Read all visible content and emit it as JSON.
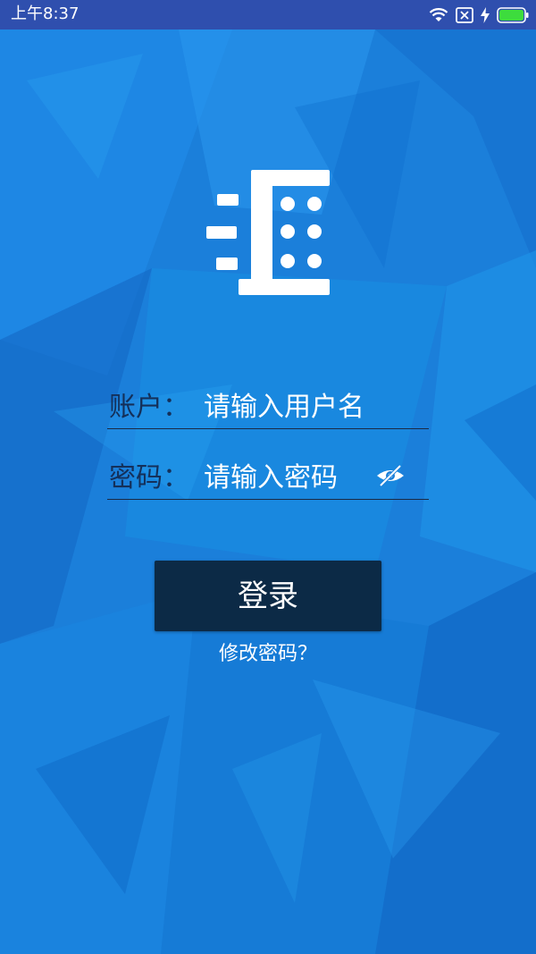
{
  "status_bar": {
    "time": "上午8:37",
    "icons": [
      "wifi-icon",
      "sim-disabled-icon",
      "charging-icon",
      "battery-icon"
    ]
  },
  "logo": {
    "icon": "building-logo-icon"
  },
  "form": {
    "account": {
      "label": "账户：",
      "placeholder": "请输入用户名",
      "value": ""
    },
    "password": {
      "label": "密码：",
      "placeholder": "请输入密码",
      "value": "",
      "toggle_icon": "eye-hidden-icon"
    }
  },
  "actions": {
    "login_label": "登录",
    "change_password_label": "修改密码？"
  },
  "colors": {
    "background": "#1a7fd9",
    "status_bar": "#2f4fae",
    "button": "#0c2a46",
    "label": "#14305a",
    "text": "#ffffff"
  }
}
